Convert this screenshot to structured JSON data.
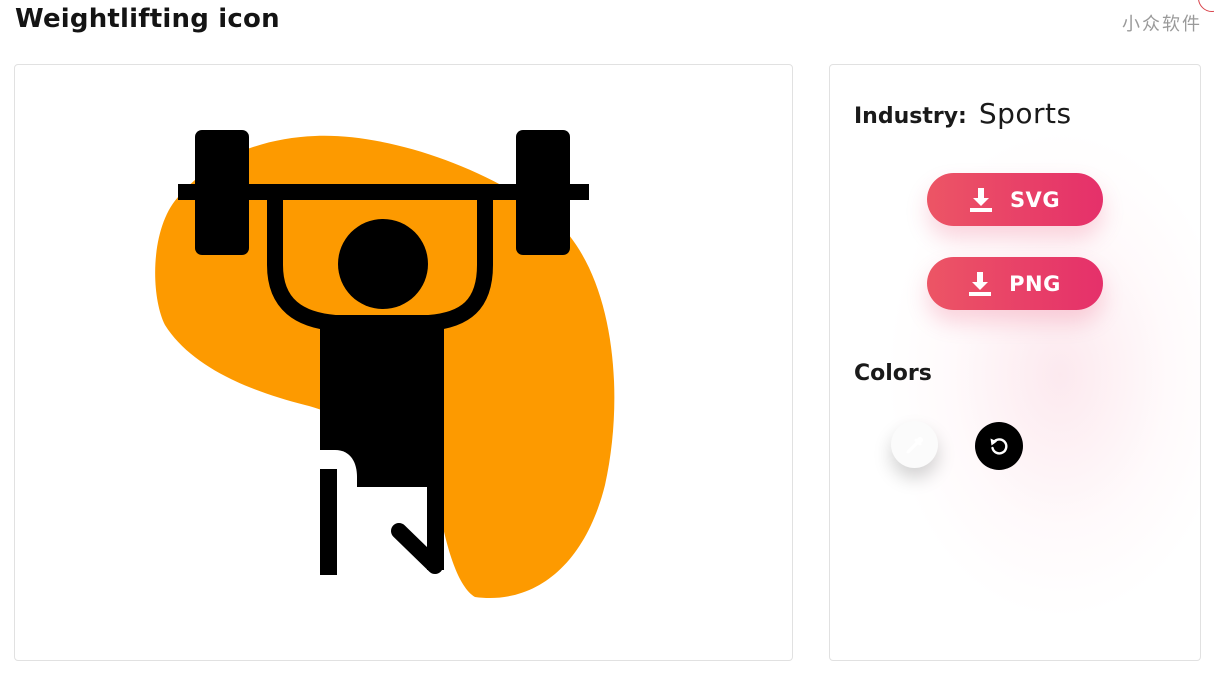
{
  "page": {
    "title": "Weightlifting icon",
    "watermark": "小众软件"
  },
  "preview": {
    "icon_name": "weightlifting-icon",
    "colors": {
      "blob": "#fd9a00",
      "figure": "#000000"
    }
  },
  "details": {
    "industry_label": "Industry:",
    "industry_value": "Sports",
    "download_buttons": [
      {
        "label": "SVG",
        "icon": "download-icon"
      },
      {
        "label": "PNG",
        "icon": "download-icon"
      }
    ],
    "button_gradient": [
      "#ec5565",
      "#e5306a"
    ],
    "colors_title": "Colors",
    "swatch": {
      "icon": "eyedropper-icon",
      "color": "#ffffff"
    },
    "reset": {
      "icon": "reset-icon",
      "color": "#000000"
    }
  }
}
